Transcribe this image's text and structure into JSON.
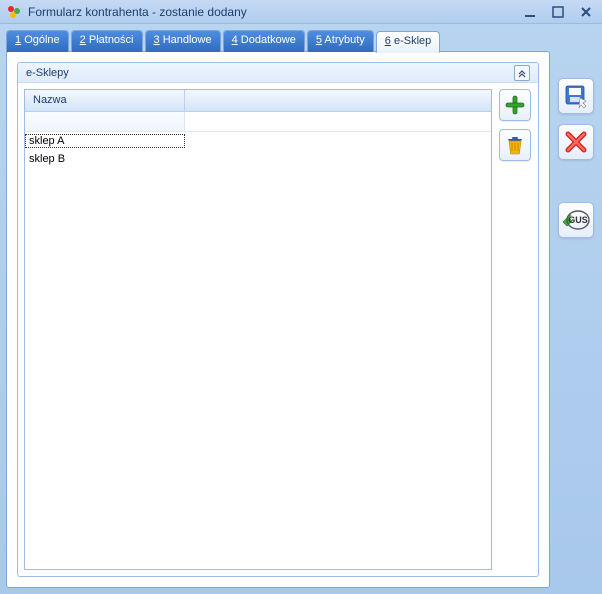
{
  "window": {
    "title": "Formularz kontrahenta - zostanie dodany"
  },
  "tabs": [
    {
      "num": "1",
      "label": "Ogólne"
    },
    {
      "num": "2",
      "label": "Płatności"
    },
    {
      "num": "3",
      "label": "Handlowe"
    },
    {
      "num": "4",
      "label": "Dodatkowe"
    },
    {
      "num": "5",
      "label": "Atrybuty"
    },
    {
      "num": "6",
      "label": "e-Sklep"
    }
  ],
  "group": {
    "title": "e-Sklepy"
  },
  "table": {
    "columns": [
      "Nazwa"
    ],
    "rows": [
      {
        "name": "sklep A",
        "selected": true
      },
      {
        "name": "sklep B",
        "selected": false
      }
    ]
  },
  "icons": {
    "add": "add-icon",
    "delete": "delete-icon",
    "save": "save-icon",
    "cancel": "cancel-icon",
    "gus": "gus-icon",
    "gus_label": "GUS"
  }
}
